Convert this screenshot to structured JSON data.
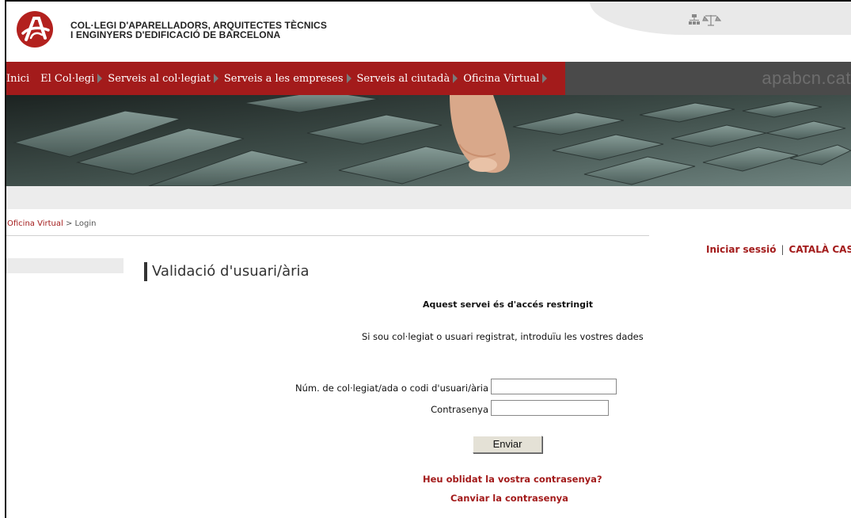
{
  "header": {
    "org_line_1": "COL·LEGI D'APARELLADORS, ARQUITECTES TÈCNICS",
    "org_line_2": "I ENGINYERS D'EDIFICACIÓ DE BARCELONA",
    "icons": [
      "sitemap-icon",
      "legal-scale-icon"
    ]
  },
  "nav": {
    "items": [
      {
        "label": "Inici"
      },
      {
        "label": "El Col·legi"
      },
      {
        "label": "Serveis al col·legiat"
      },
      {
        "label": "Serveis a les empreses"
      },
      {
        "label": "Serveis al ciutadà"
      },
      {
        "label": "Oficina Virtual"
      }
    ],
    "brand_url": "apabcn.cat"
  },
  "breadcrumb": {
    "parent": "Oficina Virtual",
    "separator": " > ",
    "current": "Login"
  },
  "session": {
    "login_label": "Iniciar sessió",
    "separator": "|",
    "lang_catala": "CATALÀ",
    "lang_castellano": "CASTE"
  },
  "main": {
    "title": "Validació d'usuari/ària",
    "restricted_notice": "Aquest servei és d'accés restringit",
    "intro": "Si sou col·legiat o usuari registrat, introduïu les vostres dades",
    "username_label": "Núm. de col·legiat/ada o codi d'usuari/ària",
    "username_value": "",
    "password_label": "Contrasenya",
    "password_value": "",
    "submit_label": "Enviar",
    "forgot_link": "Heu oblidat la vostra contrasenya?",
    "change_link": "Canviar la contrasenya"
  },
  "colors": {
    "brand_red": "#a31b1b",
    "nav_grey": "#4a4a4a"
  }
}
